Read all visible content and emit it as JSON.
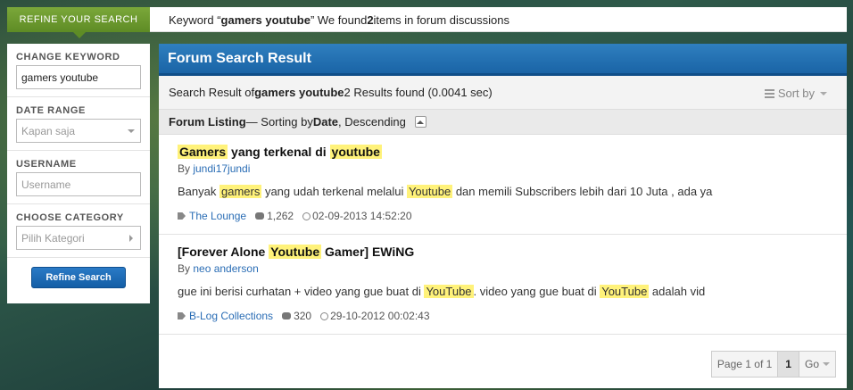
{
  "topbar": {
    "refine_label": "REFINE YOUR SEARCH",
    "msg_prefix": "Keyword “",
    "keyword": "gamers youtube",
    "msg_mid": "” We found ",
    "count": "2",
    "msg_suffix": " items in forum discussions"
  },
  "sidebar": {
    "change_keyword_label": "CHANGE KEYWORD",
    "keyword_value": "gamers youtube",
    "date_range_label": "DATE RANGE",
    "date_range_value": "Kapan saja",
    "username_label": "USERNAME",
    "username_placeholder": "Username",
    "category_label": "CHOOSE CATEGORY",
    "category_value": "Pilih Kategori",
    "refine_button": "Refine Search"
  },
  "panel": {
    "title": "Forum Search Result",
    "summary_prefix": "Search Result of ",
    "summary_keyword": "gamers youtube",
    "summary_suffix": " 2 Results found (0.0041 sec)",
    "sort_label": "Sort by",
    "listing_label": "Forum Listing",
    "listing_mid": " — Sorting by ",
    "listing_sort": "Date",
    "listing_order": ", Descending"
  },
  "results": [
    {
      "title_parts": [
        "Gamers",
        " yang terkenal di ",
        "youtube"
      ],
      "by_prefix": "By ",
      "author": "jundi17jundi",
      "body_parts": [
        "Banyak ",
        "gamers",
        " yang udah terkenal melalui ",
        "Youtube",
        " dan memili Subscribers lebih dari 10 Juta , ada ya"
      ],
      "forum": "The Lounge",
      "replies": "1,262",
      "date": "02-09-2013 14:52:20"
    },
    {
      "title_parts": [
        "[Forever Alone ",
        "Youtube",
        " Gamer] EWiNG"
      ],
      "by_prefix": "By ",
      "author": "neo anderson",
      "body_parts": [
        "gue ini berisi curhatan + video yang gue buat di ",
        "YouTube",
        ". video yang gue buat di ",
        "YouTube",
        " adalah vid"
      ],
      "forum": "B-Log Collections",
      "replies": "320",
      "date": "29-10-2012 00:02:43"
    }
  ],
  "pager": {
    "info": "Page 1 of 1",
    "current": "1",
    "go": "Go"
  }
}
